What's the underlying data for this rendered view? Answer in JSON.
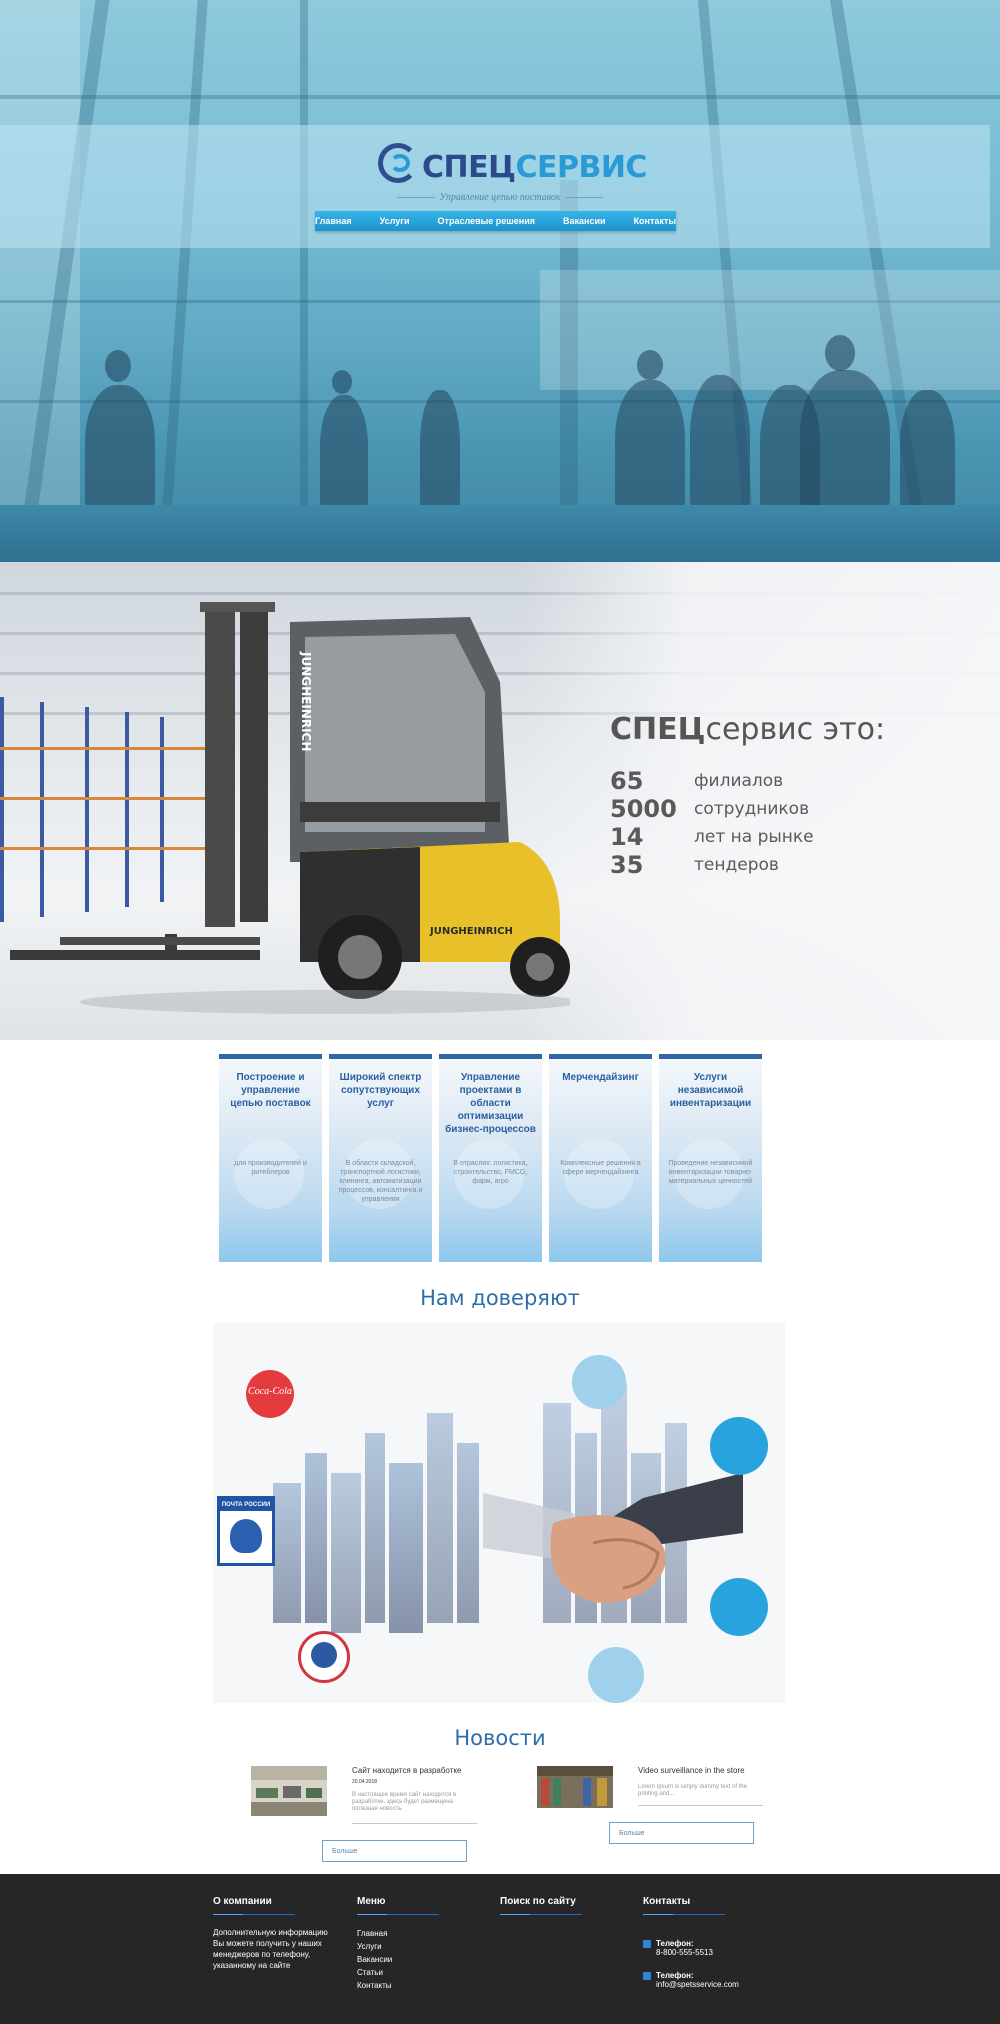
{
  "brand": {
    "name_part1": "СПЕЦ",
    "name_part2": "СЕРВИС",
    "tagline": "Управление цепью поставок"
  },
  "nav": [
    {
      "label": "Главная"
    },
    {
      "label": "Услуги"
    },
    {
      "label": "Отраслевые решения"
    },
    {
      "label": "Вакансии"
    },
    {
      "label": "Контакты"
    }
  ],
  "stats": {
    "title_bold": "СПЕЦ",
    "title_rest": "сервис это:",
    "items": [
      {
        "num": "65",
        "label": "филиалов"
      },
      {
        "num": "5000",
        "label": "сотрудников"
      },
      {
        "num": "14",
        "label": "лет на рынке"
      },
      {
        "num": "35",
        "label": "тендеров"
      }
    ],
    "forklift_brand": "JUNGHEINRICH"
  },
  "services": [
    {
      "title": "Построение и управление цепью поставок",
      "desc": "для производителей и ритейлеров"
    },
    {
      "title": "Широкий спектр сопутствующих услуг",
      "desc": "В области складской, транспортной логистики, клининга, автоматизации процессов, консалтинга и управления"
    },
    {
      "title": "Управление проектами в области оптимизации бизнес-процессов",
      "desc": "В отраслях: логистика, строительство, FMCG, фарм, агро"
    },
    {
      "title": "Мерчендайзинг",
      "desc": "Комплексные решения в сфере мерчендайзинга"
    },
    {
      "title": "Услуги независимой инвентаризации",
      "desc": "Проведение независимой инвентаризации товарно-материальных ценностей"
    }
  ],
  "trust": {
    "title": "Нам доверяют",
    "partners": {
      "coke": "Coca-Cola",
      "post": "ПОЧТА РОССИИ"
    }
  },
  "news": {
    "title": "Новости",
    "items": [
      {
        "headline": "Сайт находится в разработке",
        "date": "20.04.2018",
        "text": "В настоящее время сайт находится в разработке, здесь будет размещена полезная новость."
      },
      {
        "headline": "Video surveillance in the store",
        "date": "",
        "text": "Lorem Ipsum is simply dummy text of the printing and..."
      }
    ],
    "more_label": "Больше"
  },
  "footer": {
    "about_title": "О компании",
    "about_text": "Дополнительную информацию Вы можете получить у наших менеджеров по телефону, указанному на сайте",
    "menu_title": "Меню",
    "menu_items": [
      "Главная",
      "Услуги",
      "Вакансии",
      "Статьи",
      "Контакты"
    ],
    "search_title": "Поиск по сайту",
    "contacts_title": "Контакты",
    "phone_label": "Телефон:",
    "phone_value": "8-800-555-5513",
    "email_label": "Телефон:",
    "email_value": "info@spetsservice.com"
  },
  "colors": {
    "accent": "#2e6ea8",
    "nav": "#1d93cf",
    "footer_bg": "#262626",
    "brand_dark": "#2c4a8a",
    "brand_light": "#2a9ad4"
  }
}
